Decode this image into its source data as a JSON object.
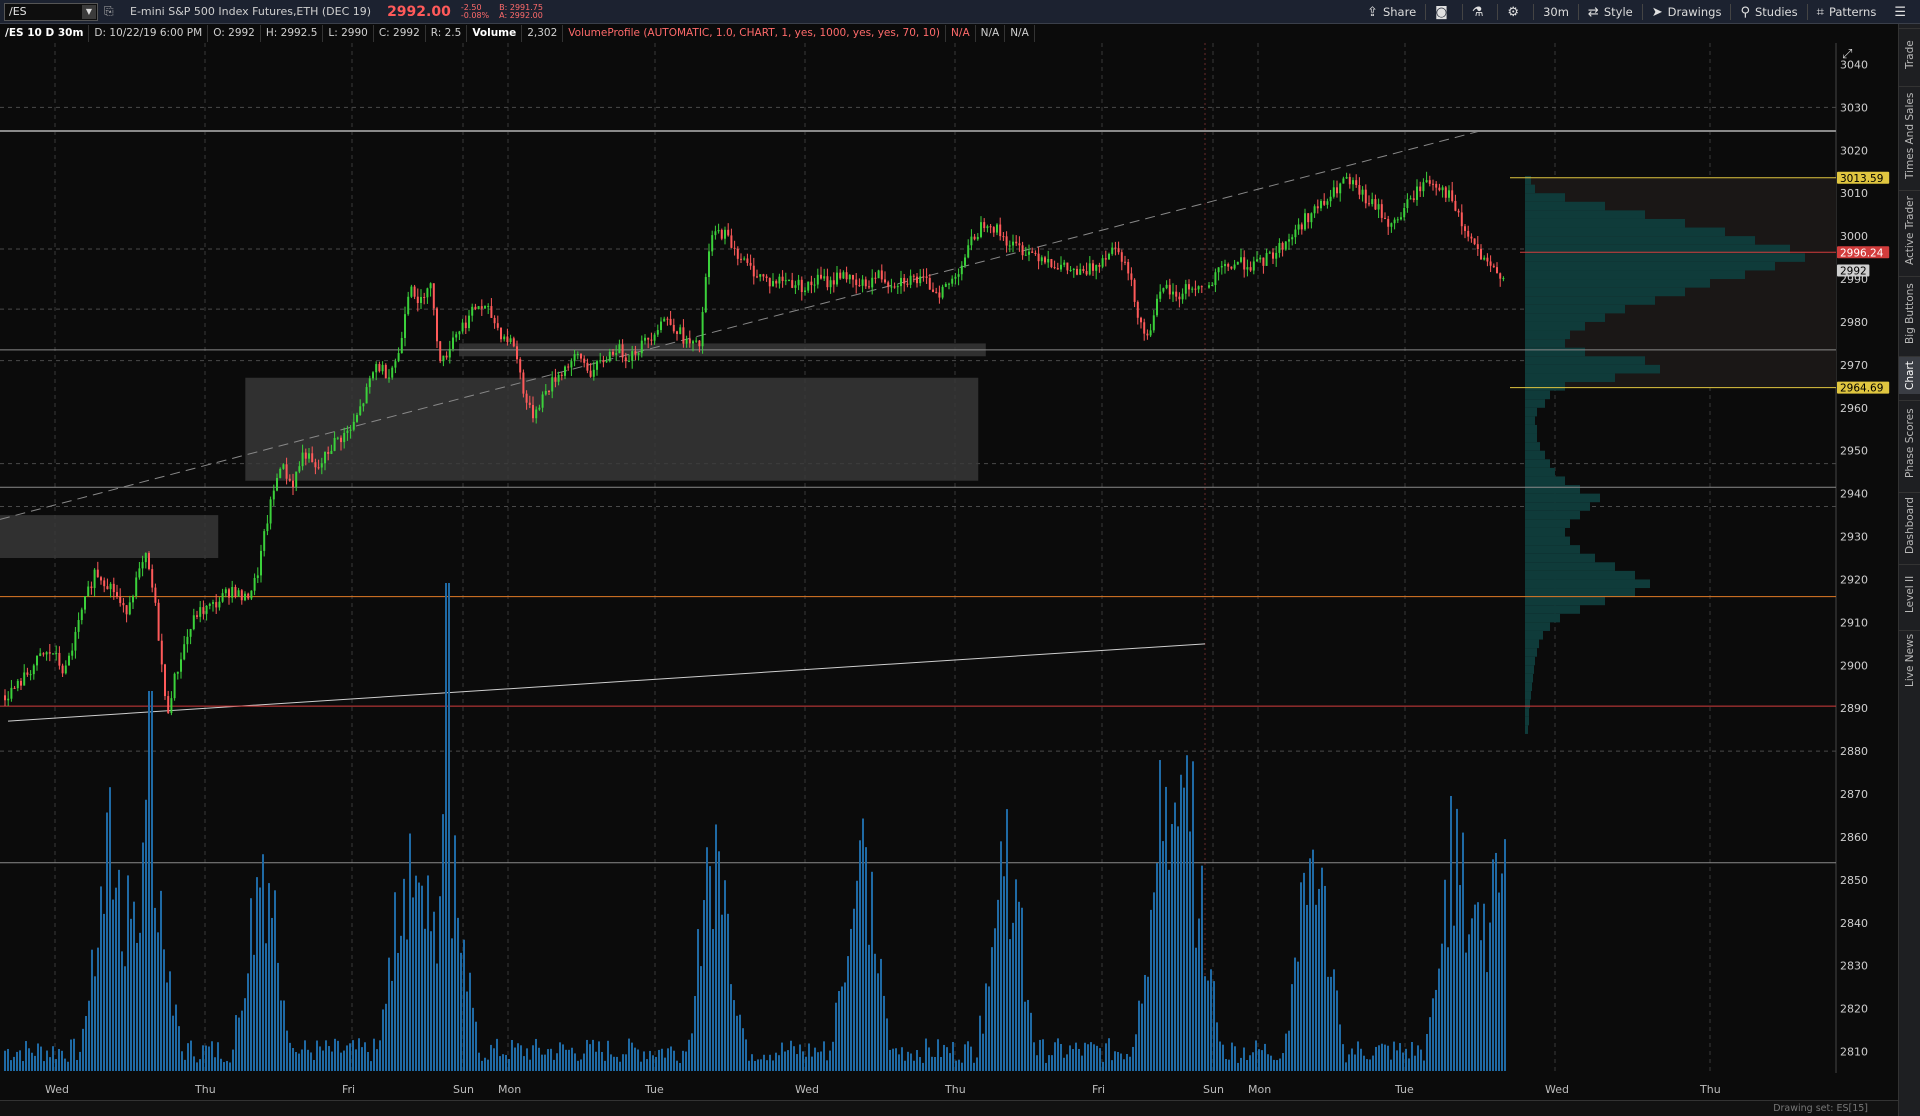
{
  "toolbar": {
    "symbol": "/ES",
    "description": "E-mini S&P 500 Index Futures,ETH (DEC 19)",
    "last_price": "2992.00",
    "net_change": "-2.50",
    "pct_change": "-0.08%",
    "bid": "B: 2991.75",
    "ask": "A: 2992.00",
    "share_label": "Share",
    "timeframe_label": "30m",
    "style_label": "Style",
    "drawings_label": "Drawings",
    "studies_label": "Studies",
    "patterns_label": "Patterns"
  },
  "status": {
    "chart_id": "/ES 10 D 30m",
    "date": "D: 10/22/19 6:00 PM",
    "open": "O: 2992",
    "high": "H: 2992.5",
    "low": "L: 2990",
    "close": "C: 2992",
    "range": "R: 2.5",
    "volume_label": "Volume",
    "volume_value": "2,302",
    "volume_profile": "VolumeProfile (AUTOMATIC, 1.0, CHART, 1, yes, 1000, yes, yes, 70, 10)",
    "na1": "N/A",
    "na2": "N/A",
    "na3": "N/A"
  },
  "side_tabs": [
    "Trade",
    "Times And Sales",
    "Active Trader",
    "Big Buttons",
    "Chart",
    "Phase Scores",
    "Dashboard",
    "Level II",
    "Live News"
  ],
  "active_side_tab": "Chart",
  "bottom": {
    "drawing_set": "Drawing set: ES[15]"
  },
  "colors": {
    "up": "#3bd13b",
    "down": "#ff5a5a",
    "volume": "#1f6aa5",
    "profile": "#0e3a3a",
    "level_yellow": "#e0c640",
    "level_orange": "#e07a26",
    "level_red": "#d23c3c"
  },
  "chart_data": {
    "type": "candlestick",
    "price_axis": {
      "min": 2805,
      "max": 3045,
      "ticks": [
        3040,
        3030,
        3020,
        3010,
        3000,
        2990,
        2980,
        2970,
        2960,
        2950,
        2940,
        2930,
        2920,
        2910,
        2900,
        2890,
        2880,
        2870,
        2860,
        2850,
        2840,
        2830,
        2820,
        2810
      ]
    },
    "day_labels": [
      "Wed",
      "Thu",
      "Fri",
      "Sun",
      "Mon",
      "Tue",
      "Wed",
      "Thu",
      "Fri",
      "Sun",
      "Mon",
      "Tue",
      "Wed",
      "Thu"
    ],
    "price_path": [
      [
        0,
        2893
      ],
      [
        0.01,
        2895
      ],
      [
        0.03,
        2902
      ],
      [
        0.04,
        2903
      ],
      [
        0.05,
        2898
      ],
      [
        0.065,
        2913
      ],
      [
        0.075,
        2922
      ],
      [
        0.09,
        2918
      ],
      [
        0.1,
        2912
      ],
      [
        0.11,
        2920
      ],
      [
        0.118,
        2925
      ],
      [
        0.125,
        2915
      ],
      [
        0.13,
        2903
      ],
      [
        0.135,
        2888
      ],
      [
        0.14,
        2895
      ],
      [
        0.15,
        2905
      ],
      [
        0.16,
        2912
      ],
      [
        0.175,
        2914
      ],
      [
        0.19,
        2918
      ],
      [
        0.2,
        2915
      ],
      [
        0.21,
        2920
      ],
      [
        0.22,
        2935
      ],
      [
        0.23,
        2947
      ],
      [
        0.24,
        2942
      ],
      [
        0.25,
        2950
      ],
      [
        0.26,
        2945
      ],
      [
        0.275,
        2952
      ],
      [
        0.29,
        2955
      ],
      [
        0.3,
        2962
      ],
      [
        0.31,
        2970
      ],
      [
        0.32,
        2968
      ],
      [
        0.33,
        2973
      ],
      [
        0.335,
        2985
      ],
      [
        0.34,
        2990
      ],
      [
        0.345,
        2983
      ],
      [
        0.35,
        2987
      ],
      [
        0.355,
        2990
      ],
      [
        0.36,
        2978
      ],
      [
        0.365,
        2970
      ],
      [
        0.375,
        2977
      ],
      [
        0.385,
        2980
      ],
      [
        0.395,
        2984
      ],
      [
        0.405,
        2982
      ],
      [
        0.415,
        2977
      ],
      [
        0.425,
        2975
      ],
      [
        0.435,
        2962
      ],
      [
        0.44,
        2958
      ],
      [
        0.45,
        2963
      ],
      [
        0.46,
        2967
      ],
      [
        0.47,
        2970
      ],
      [
        0.48,
        2972
      ],
      [
        0.49,
        2968
      ],
      [
        0.5,
        2971
      ],
      [
        0.51,
        2974
      ],
      [
        0.52,
        2972
      ],
      [
        0.53,
        2974
      ],
      [
        0.54,
        2977
      ],
      [
        0.55,
        2981
      ],
      [
        0.56,
        2979
      ],
      [
        0.57,
        2975
      ],
      [
        0.58,
        2974
      ],
      [
        0.585,
        2988
      ],
      [
        0.59,
        3000
      ],
      [
        0.6,
        3001
      ],
      [
        0.61,
        2997
      ],
      [
        0.62,
        2993
      ],
      [
        0.63,
        2991
      ],
      [
        0.64,
        2989
      ],
      [
        0.65,
        2990
      ],
      [
        0.66,
        2989
      ],
      [
        0.67,
        2988
      ],
      [
        0.68,
        2990
      ],
      [
        0.69,
        2989
      ],
      [
        0.7,
        2992
      ],
      [
        0.71,
        2988
      ],
      [
        0.72,
        2989
      ],
      [
        0.73,
        2991
      ],
      [
        0.74,
        2989
      ],
      [
        0.75,
        2990
      ],
      [
        0.76,
        2990
      ],
      [
        0.77,
        2989
      ],
      [
        0.78,
        2987
      ],
      [
        0.79,
        2989
      ],
      [
        0.8,
        2994
      ],
      [
        0.81,
        3000
      ],
      [
        0.82,
        3004
      ],
      [
        0.83,
        3001
      ],
      [
        0.84,
        2998
      ],
      [
        0.85,
        2997
      ],
      [
        0.86,
        2996
      ],
      [
        0.87,
        2995
      ],
      [
        0.88,
        2993
      ],
      [
        0.89,
        2992
      ],
      [
        0.9,
        2991
      ],
      [
        0.91,
        2993
      ],
      [
        0.92,
        2996
      ],
      [
        0.93,
        2998
      ],
      [
        0.935,
        2994
      ],
      [
        0.94,
        2990
      ],
      [
        0.945,
        2984
      ],
      [
        0.95,
        2979
      ],
      [
        0.955,
        2976
      ],
      [
        0.96,
        2983
      ],
      [
        0.97,
        2988
      ],
      [
        0.98,
        2985
      ],
      [
        0.985,
        2988
      ]
    ],
    "price_path2": [
      [
        0,
        2988
      ],
      [
        0.04,
        2992
      ],
      [
        0.1,
        2994
      ],
      [
        0.16,
        2993
      ],
      [
        0.22,
        2996
      ],
      [
        0.28,
        3000
      ],
      [
        0.34,
        3005
      ],
      [
        0.4,
        3008
      ],
      [
        0.46,
        3013
      ],
      [
        0.5,
        3011
      ],
      [
        0.54,
        3008
      ],
      [
        0.58,
        3006
      ],
      [
        0.62,
        3002
      ],
      [
        0.66,
        3006
      ],
      [
        0.7,
        3010
      ],
      [
        0.74,
        3013
      ],
      [
        0.78,
        3012
      ],
      [
        0.82,
        3009
      ],
      [
        0.86,
        3002
      ],
      [
        0.9,
        2998
      ],
      [
        0.94,
        2993
      ],
      [
        1,
        2991
      ]
    ],
    "overlays": {
      "horizontal_levels": [
        {
          "price": 3024.5,
          "color": "#8a8a8a"
        },
        {
          "price": 2973.5,
          "color": "#8a8a8a"
        },
        {
          "price": 2941.5,
          "color": "#8a8a8a"
        },
        {
          "price": 2916,
          "color": "#e07a26"
        },
        {
          "price": 2890.5,
          "color": "#d23c3c"
        },
        {
          "price": 2854,
          "color": "#8a8a8a"
        }
      ],
      "dashed_levels": [
        3030,
        2997,
        2983,
        2971,
        2947,
        2937,
        2880
      ],
      "price_tags": [
        {
          "price": 3013.59,
          "label": "3013.59",
          "color": "#e0c640"
        },
        {
          "price": 2996.24,
          "label": "2996.24",
          "color": "#d23c3c"
        },
        {
          "price": 2992,
          "label": "2992",
          "color": "#cfcfcf"
        },
        {
          "price": 2964.69,
          "label": "2964.69",
          "color": "#e0c640"
        }
      ],
      "zones": [
        {
          "x0": 0.0,
          "x1": 0.145,
          "p0": 2935,
          "p1": 2925
        },
        {
          "x0": 0.163,
          "x1": 0.65,
          "p0": 2967,
          "p1": 2943
        },
        {
          "x0": 0.305,
          "x1": 0.655,
          "p0": 2975,
          "p1": 2972
        }
      ]
    }
  }
}
